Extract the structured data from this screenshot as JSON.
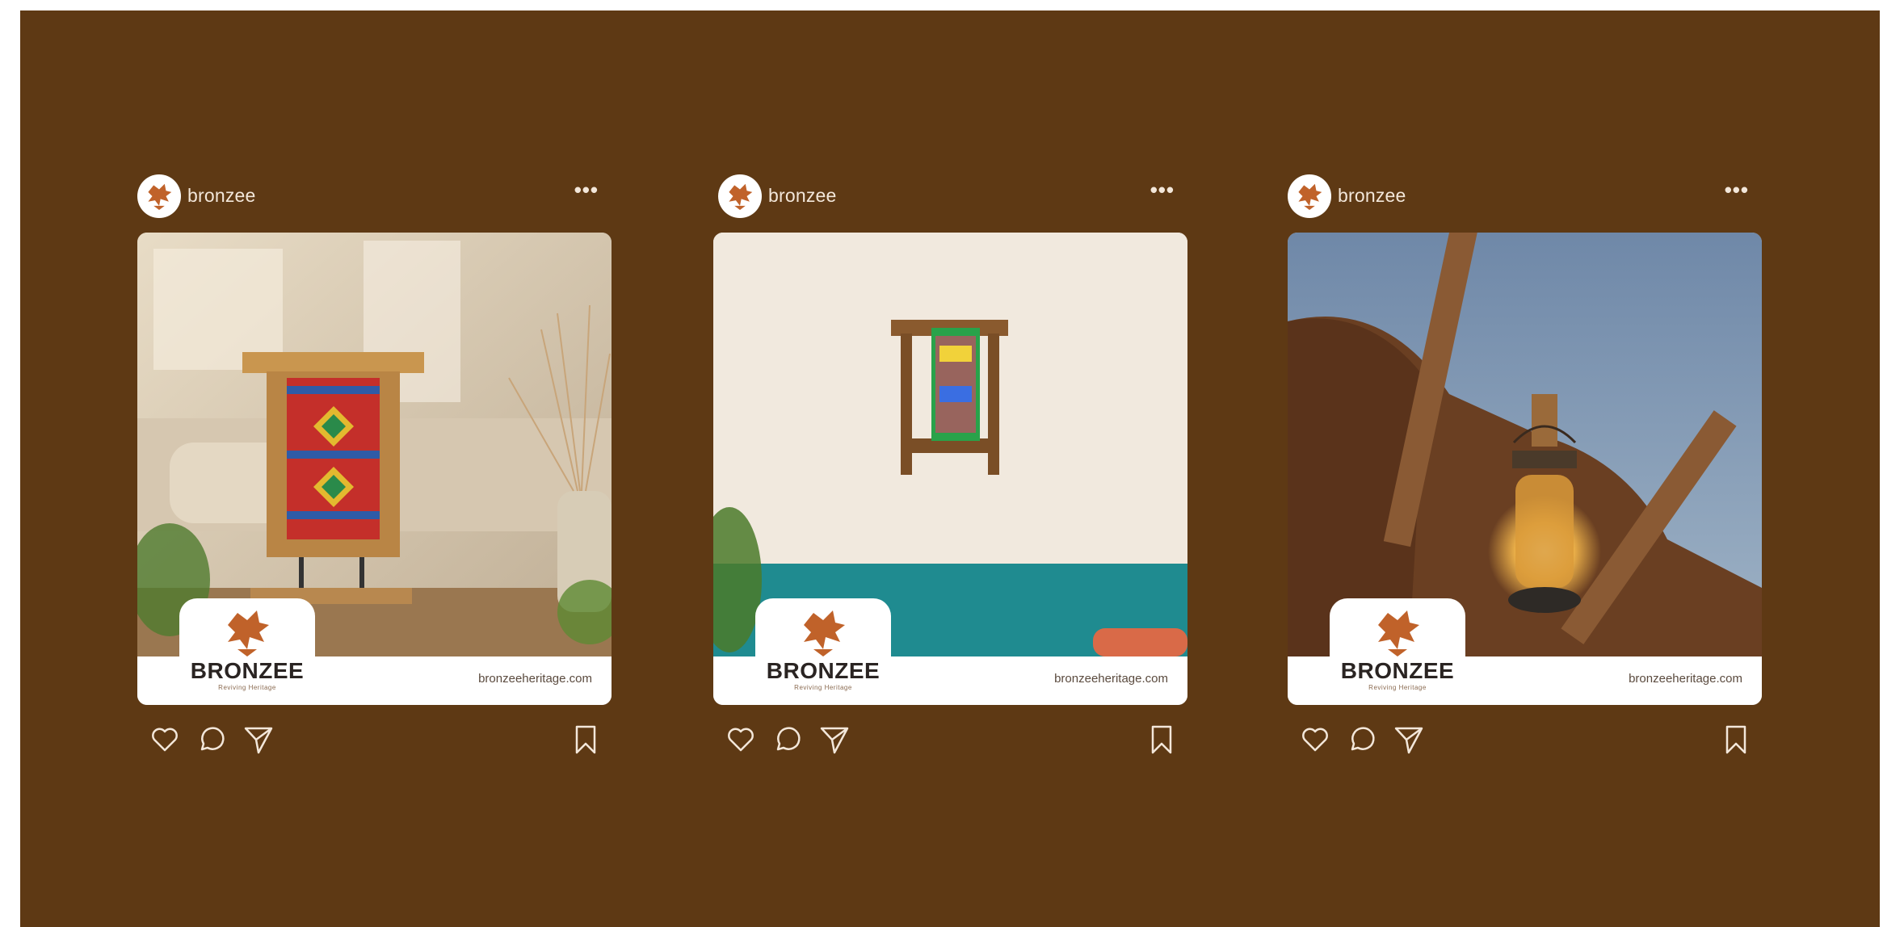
{
  "posts": [
    {
      "username": "bronzee",
      "more_icon": "more-horizontal-icon",
      "photo_subject": "painted wooden cabinet with plant",
      "brand": {
        "name": "BRONZEE",
        "tagline": "Reviving Heritage"
      },
      "website": "bronzeeheritage.com",
      "actions": [
        "heart-icon",
        "comment-icon",
        "share-icon",
        "bookmark-icon"
      ]
    },
    {
      "username": "bronzee",
      "more_icon": "more-horizontal-icon",
      "photo_subject": "wall shelf on cream wall with teal band",
      "brand": {
        "name": "BRONZEE",
        "tagline": "Reviving Heritage"
      },
      "website": "bronzeeheritage.com",
      "actions": [
        "heart-icon",
        "comment-icon",
        "share-icon",
        "bookmark-icon"
      ]
    },
    {
      "username": "bronzee",
      "more_icon": "more-horizontal-icon",
      "photo_subject": "lantern hanging from wooden beams",
      "brand": {
        "name": "BRONZEE",
        "tagline": "Reviving Heritage"
      },
      "website": "bronzeeheritage.com",
      "actions": [
        "heart-icon",
        "comment-icon",
        "share-icon",
        "bookmark-icon"
      ]
    }
  ],
  "colors": {
    "background": "#5e3914",
    "brand_orange": "#c0622a",
    "text_light": "#f3e7da",
    "brand_dark": "#2a2422"
  }
}
